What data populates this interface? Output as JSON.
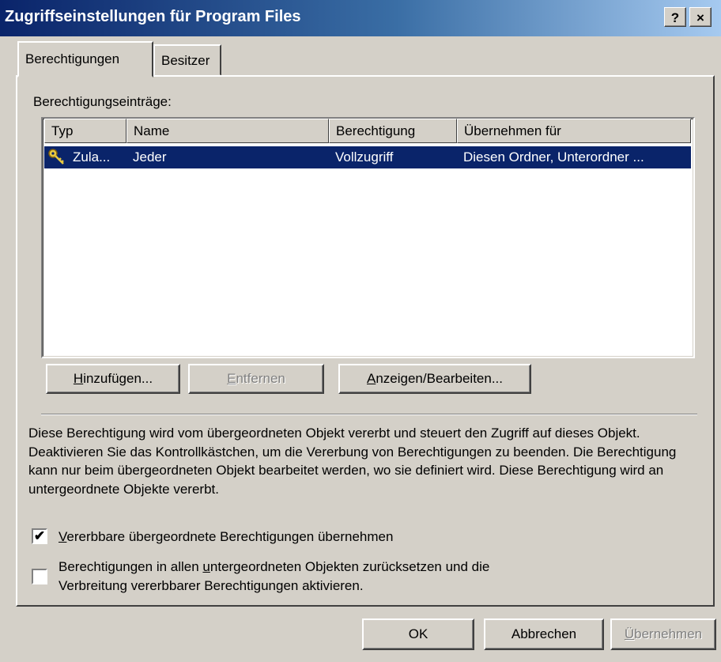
{
  "window": {
    "title": "Zugriffseinstellungen für Program Files",
    "help_button": "?",
    "close_button": "×"
  },
  "tabs": [
    {
      "label": "Berechtigungen",
      "active": true
    },
    {
      "label": "Besitzer",
      "active": false
    }
  ],
  "permissions": {
    "list_label": "Berechtigungseinträge:",
    "columns": [
      "Typ",
      "Name",
      "Berechtigung",
      "Übernehmen für"
    ],
    "rows": [
      {
        "icon": "key-icon",
        "typ": "Zula...",
        "name": "Jeder",
        "berechtigung": "Vollzugriff",
        "uebernehmen": "Diesen Ordner, Unterordner ...",
        "selected": true
      }
    ]
  },
  "buttons": {
    "add": "Hinzufügen...",
    "remove": "Entfernen",
    "view_edit": "Anzeigen/Bearbeiten..."
  },
  "description": "Diese Berechtigung wird vom übergeordneten Objekt vererbt und steuert den Zugriff auf dieses Objekt. Deaktivieren Sie das Kontrollkästchen, um die Vererbung von Berechtigungen zu beenden. Die Berechtigung kann nur beim übergeordneten Objekt bearbeitet werden, wo sie definiert wird. Diese Berechtigung wird an untergeordnete Objekte vererbt.",
  "checkboxes": [
    {
      "label": "Vererbbare übergeordnete Berechtigungen übernehmen",
      "checked": true
    },
    {
      "label_line1": "Berechtigungen in allen untergeordneten Objekten zurücksetzen und die",
      "label_line2": "Verbreitung vererbbarer Berechtigungen aktivieren.",
      "checked": false
    }
  ],
  "footer": {
    "ok": "OK",
    "cancel": "Abbrechen",
    "apply": "Übernehmen"
  }
}
